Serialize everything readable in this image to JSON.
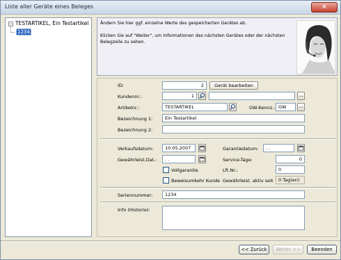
{
  "window": {
    "title": "Liste aller Geräte eines Beleges",
    "close_glyph": "✕"
  },
  "tree": {
    "root_label": "TESTARTIKEL, Ein Testartikel",
    "toggle_glyph": "−",
    "child_label": "1234"
  },
  "info": {
    "line1": "Ändern Sie hier ggf. einzelne Werte des gespeicherten Gerätes ab.",
    "line2": "Klicken Sie auf \"Weiter\", um Informationen des nächsten Gerätes oder der nächsten Belegzeile zu sehen."
  },
  "form": {
    "id_label": "ID:",
    "id_value": "2",
    "edit_device_button": "Gerät bearbeiten",
    "customer_label": "Kundennr.:",
    "customer_value": "1",
    "customer_name_value": "",
    "article_label": "Artikelnr.:",
    "article_value": "TESTARTIKEL",
    "gw_label": "GW-Kennz.:",
    "gw_value": "GW",
    "desc1_label": "Bezeichnung 1:",
    "desc1_value": "Ein Testartikel",
    "desc2_label": "Bezeichnung 2:",
    "desc2_value": "",
    "sale_date_label": "Verkaufsdatum:",
    "sale_date_value": "10.05.2007",
    "warranty_date_label": "Garantiedatum:",
    "warranty_date_value": " .  .",
    "warranty_until_label": "Gewährleist.Dat.:",
    "warranty_until_value": " .  .",
    "service_days_label": "Service-Tage:",
    "service_days_value": "0",
    "full_warranty_label": "Vollgarantie",
    "supplier_label": "Lft.Nr.:",
    "supplier_value": "0",
    "burden_label": "Beweisumkehr Kunde",
    "warranty_active_label": "Gewährleist. aktiv seit",
    "warranty_active_value": "0 Tag(en)",
    "serial_label": "Seriennummer:",
    "serial_value": "1234",
    "history_label": "Info (Historie):",
    "history_value": ""
  },
  "icons": {
    "search": "search-icon",
    "calendar": "calendar-icon",
    "ellipsis": "..."
  },
  "footer": {
    "back_label": "<< Zurück",
    "next_label": "Weiter >>",
    "finish_label": "Beenden"
  }
}
